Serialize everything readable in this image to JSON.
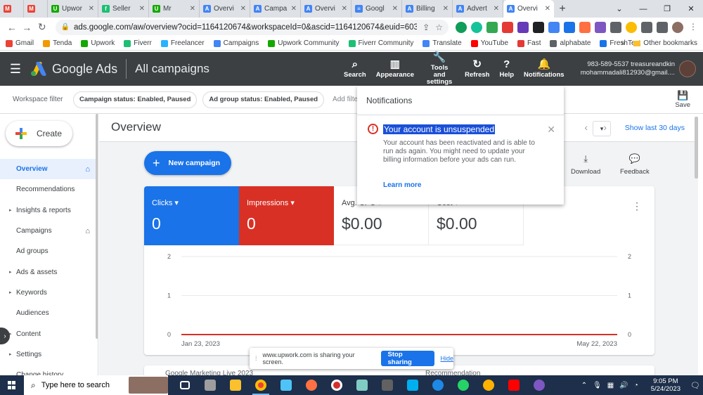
{
  "browser": {
    "tabs": [
      {
        "title": "",
        "color": "#ea4335",
        "icon_name": "gmail-icon",
        "glyph": "M",
        "small": true
      },
      {
        "title": "",
        "color": "#ea4335",
        "icon_name": "gmail-icon",
        "glyph": "M",
        "small": true
      },
      {
        "title": "Upwor",
        "color": "#14a800",
        "icon_name": "upwork-icon",
        "glyph": "U"
      },
      {
        "title": "Seller",
        "color": "#1dbf73",
        "icon_name": "fiverr-icon",
        "glyph": "f"
      },
      {
        "title": "Mr",
        "color": "#14a800",
        "icon_name": "upwork-icon",
        "glyph": "U"
      },
      {
        "title": "Overvi",
        "color": "#4285f4",
        "icon_name": "google-ads-icon",
        "glyph": "A"
      },
      {
        "title": "Campa",
        "color": "#4285f4",
        "icon_name": "google-ads-icon",
        "glyph": "A"
      },
      {
        "title": "Overvi",
        "color": "#4285f4",
        "icon_name": "google-ads-icon",
        "glyph": "A"
      },
      {
        "title": "Googl",
        "color": "#4285f4",
        "icon_name": "google-docs-icon",
        "glyph": "≡"
      },
      {
        "title": "Billing",
        "color": "#4285f4",
        "icon_name": "google-ads-icon",
        "glyph": "A"
      },
      {
        "title": "Advert",
        "color": "#4285f4",
        "icon_name": "google-ads-icon",
        "glyph": "A"
      },
      {
        "title": "Overvi",
        "color": "#4285f4",
        "icon_name": "google-ads-icon",
        "glyph": "A",
        "active": true
      }
    ],
    "url": "ads.google.com/aw/overview?ocid=1164120674&workspaceId=0&ascid=1164120674&euid=603997854...",
    "bookmarks": [
      {
        "label": "Gmail",
        "color": "#ea4335"
      },
      {
        "label": "Tenda",
        "color": "#f29900"
      },
      {
        "label": "Upwork",
        "color": "#14a800"
      },
      {
        "label": "Fiverr",
        "color": "#1dbf73"
      },
      {
        "label": "Freelancer",
        "color": "#29b2fe"
      },
      {
        "label": "Campaigns",
        "color": "#4285f4"
      },
      {
        "label": "Upwork Community",
        "color": "#14a800"
      },
      {
        "label": "Fiverr Community",
        "color": "#1dbf73"
      },
      {
        "label": "Translate",
        "color": "#4285f4"
      },
      {
        "label": "YouTube",
        "color": "#ff0000"
      },
      {
        "label": "Fast",
        "color": "#e53935"
      },
      {
        "label": "alphabate",
        "color": "#5f6368"
      },
      {
        "label": "FreshText",
        "color": "#1a73e8"
      }
    ],
    "other_bookmarks": "Other bookmarks"
  },
  "ads": {
    "product": "Google Ads",
    "breadcrumb": "All campaigns",
    "actions": [
      {
        "label": "Search",
        "icon": "⌕",
        "icon_name": "search-icon"
      },
      {
        "label": "Appearance",
        "icon": "▥",
        "icon_name": "appearance-icon"
      },
      {
        "label": "Tools and settings",
        "icon": "🔧",
        "icon_name": "wrench-icon"
      },
      {
        "label": "Refresh",
        "icon": "↻",
        "icon_name": "refresh-icon"
      },
      {
        "label": "Help",
        "icon": "?",
        "icon_name": "help-icon"
      },
      {
        "label": "Notifications",
        "icon": "🔔",
        "icon_name": "bell-icon"
      }
    ],
    "account_id": "983-589-5537 treasureandkin",
    "account_email": "mohammadali812930@gmail...."
  },
  "filters": {
    "workspace_label": "Workspace filter",
    "chips": [
      "Campaign status: Enabled, Paused",
      "Ad group status: Enabled, Paused"
    ],
    "add_filter": "Add filter",
    "save": "Save"
  },
  "nav": {
    "create": "Create",
    "items": [
      {
        "label": "Overview",
        "active": true,
        "home": true
      },
      {
        "label": "Recommendations"
      },
      {
        "label": "Insights & reports",
        "arrow": true
      },
      {
        "label": "Campaigns",
        "home": true
      },
      {
        "label": "Ad groups"
      },
      {
        "label": "Ads & assets",
        "arrow": true
      },
      {
        "label": "Keywords",
        "arrow": true
      },
      {
        "label": "Audiences"
      },
      {
        "label": "Content",
        "arrow": true
      },
      {
        "label": "Settings",
        "arrow": true
      },
      {
        "label": "Change history"
      }
    ]
  },
  "overview": {
    "title": "Overview",
    "show_last": "Show last 30 days",
    "new_campaign": "New campaign",
    "download": "Download",
    "feedback": "Feedback",
    "metrics": [
      {
        "label": "Clicks",
        "value": "0"
      },
      {
        "label": "Impressions",
        "value": "0"
      },
      {
        "label": "Avg. CPC",
        "value": "$0.00"
      },
      {
        "label": "Cost",
        "value": "$0.00"
      }
    ],
    "next_card_title": "Google Marketing Live 2023",
    "next_card_right": "Recommendation"
  },
  "chart_data": {
    "type": "line",
    "x": [
      "Jan 23, 2023",
      "May 22, 2023"
    ],
    "series": [
      {
        "values": [
          0,
          0
        ],
        "color": "#1a73e8"
      },
      {
        "values": [
          0,
          0
        ],
        "color": "#d93025"
      }
    ],
    "left_ticks": [
      "2",
      "1",
      "0"
    ],
    "right_ticks": [
      "2",
      "1",
      "0"
    ],
    "ylim": [
      0,
      2
    ],
    "xlabel": "",
    "ylabel": ""
  },
  "notifications": {
    "header": "Notifications",
    "title": "Your account is unsuspended",
    "body": "Your account has been reactivated and is able to run ads again. You might need to update your billing information before your ads can run.",
    "link": "Learn more"
  },
  "screenshare": {
    "text": "www.upwork.com is sharing your screen.",
    "stop": "Stop sharing",
    "hide": "Hide"
  },
  "taskbar": {
    "search_placeholder": "Type here to search",
    "time": "9:05 PM",
    "date": "5/24/2023"
  }
}
